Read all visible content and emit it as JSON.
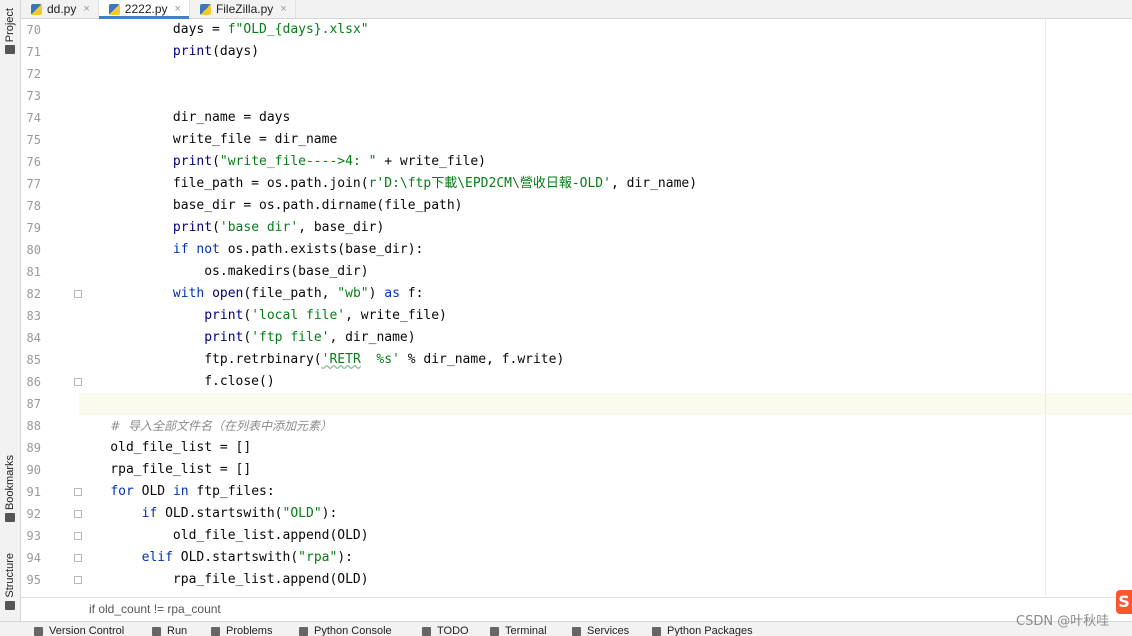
{
  "left_strip": {
    "project_label": "Project",
    "bookmarks_label": "Bookmarks",
    "structure_label": "Structure"
  },
  "tabs": [
    {
      "label": "dd.py",
      "close": "×"
    },
    {
      "label": "2222.py",
      "close": "×"
    },
    {
      "label": "FileZilla.py",
      "close": "×"
    }
  ],
  "editor": {
    "line_numbers": [
      "70",
      "71",
      "72",
      "73",
      "74",
      "75",
      "76",
      "77",
      "78",
      "79",
      "80",
      "81",
      "82",
      "83",
      "84",
      "85",
      "86",
      "87",
      "88",
      "89",
      "90",
      "91",
      "92",
      "93",
      "94",
      "95"
    ],
    "code": {
      "l70_a": "            days = ",
      "l70_b": "f\"OLD_{days}.xlsx\"",
      "l71_a": "            ",
      "l71_b": "print",
      "l71_c": "(days)",
      "l74": "            dir_name = days",
      "l75": "            write_file = dir_name",
      "l76_a": "            ",
      "l76_b": "print",
      "l76_c": "(",
      "l76_d": "\"write_file---->4: \"",
      "l76_e": " + write_file)",
      "l77_a": "            file_path = os.path.join(",
      "l77_b": "r'D:\\ftp下載\\EPD2CM\\營收日報-OLD'",
      "l77_c": ", dir_name)",
      "l78": "            base_dir = os.path.dirname(file_path)",
      "l79_a": "            ",
      "l79_b": "print",
      "l79_c": "(",
      "l79_d": "'base dir'",
      "l79_e": ", base_dir)",
      "l80_a": "            ",
      "l80_b": "if not",
      "l80_c": " os.path.exists(base_dir):",
      "l81": "                os.makedirs(base_dir)",
      "l82_a": "            ",
      "l82_b": "with",
      "l82_c": " ",
      "l82_d": "open",
      "l82_e": "(file_path, ",
      "l82_f": "\"wb\"",
      "l82_g": ") ",
      "l82_h": "as",
      "l82_i": " f:",
      "l83_a": "                ",
      "l83_b": "print",
      "l83_c": "(",
      "l83_d": "'local file'",
      "l83_e": ", write_file)",
      "l84_a": "                ",
      "l84_b": "print",
      "l84_c": "(",
      "l84_d": "'ftp file'",
      "l84_e": ", dir_name)",
      "l85_a": "                ftp.retrbinary(",
      "l85_b": "'RETR",
      "l85_c": "  %s'",
      "l85_d": " % dir_name, f.write)",
      "l86": "                f.close()",
      "l88_a": "    ",
      "l88_b": "#  导入全部文件名（在列表中添加元素）",
      "l89": "    old_file_list = []",
      "l90": "    rpa_file_list = []",
      "l91_a": "    ",
      "l91_b": "for",
      "l91_c": " OLD ",
      "l91_d": "in",
      "l91_e": " ftp_files:",
      "l92_a": "        ",
      "l92_b": "if",
      "l92_c": " OLD.startswith(",
      "l92_d": "\"OLD\"",
      "l92_e": "):",
      "l93": "            old_file_list.append(OLD)",
      "l94_a": "        ",
      "l94_b": "elif",
      "l94_c": " OLD.startswith(",
      "l94_d": "\"rpa\"",
      "l94_e": "):",
      "l95": "            rpa_file_list.append(OLD)"
    }
  },
  "breadcrumb": "if old_count != rpa_count",
  "bottom_tools": [
    "Version Control",
    "Run",
    "Problems",
    "Python Console",
    "TODO",
    "Terminal",
    "Services",
    "Python Packages"
  ],
  "watermark": "CSDN @叶秋哇",
  "csdn_logo": "S",
  "colors": {
    "keyword": "#0033b3",
    "string": "#067d17",
    "comment": "#8c8c8c",
    "caret_line": "#fcfaed",
    "active_tab_underline": "#4083c9"
  }
}
